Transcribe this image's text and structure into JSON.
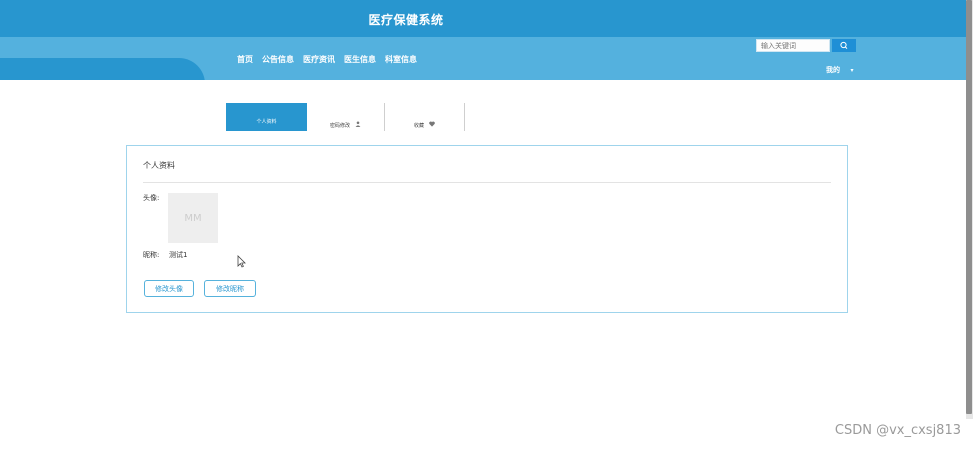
{
  "header": {
    "site_title": "医疗保健系统",
    "nav": [
      "首页",
      "公告信息",
      "医疗资讯",
      "医生信息",
      "科室信息"
    ],
    "search": {
      "placeholder": "输入关键词"
    },
    "user_menu": "我的",
    "colors": {
      "header_bg": "#2896cf",
      "nav_bg": "#54b1de"
    }
  },
  "tabs": [
    {
      "label": "个人资料",
      "active": true
    },
    {
      "label": "密码修改",
      "icon": "user-icon"
    },
    {
      "label": "收藏",
      "icon": "heart-icon"
    }
  ],
  "profile": {
    "title": "个人资料",
    "avatar_label": "头像:",
    "avatar_placeholder": "MM",
    "nickname_label": "昵称:",
    "nickname_value": "测试1",
    "btn_change_avatar": "修改头像",
    "btn_change_nickname": "修改昵称"
  },
  "watermark": "CSDN @vx_cxsj813"
}
